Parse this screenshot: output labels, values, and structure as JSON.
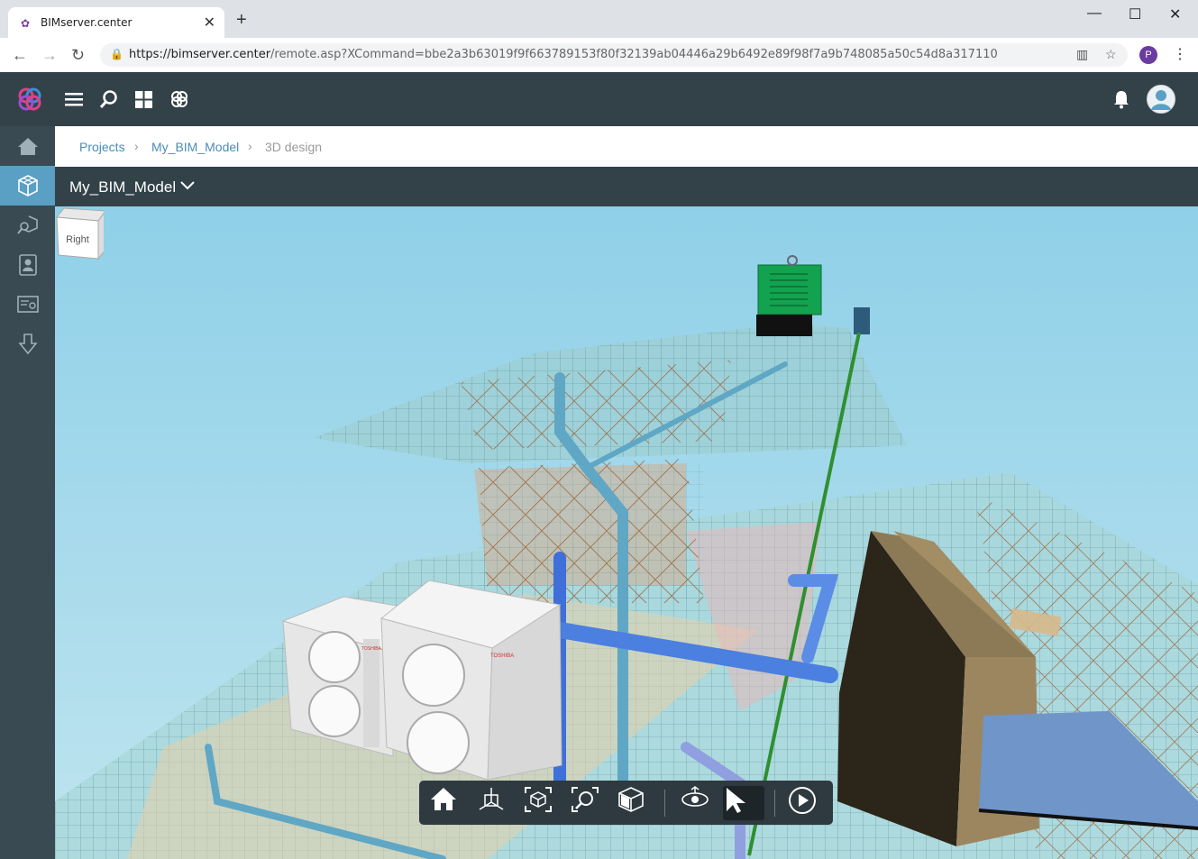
{
  "browser": {
    "tab_title": "BIMserver.center",
    "new_tab": "+",
    "tab_close": "✕",
    "url_host": "https://bimserver.center",
    "url_path": "/remote.asp?XCommand=bbe2a3b63019f9f663789153f80f32139ab04446a29b6492e89f98f7a9b748085a50c54d8a317110",
    "profile_initial": "P",
    "window_controls": {
      "minimize": "—",
      "maximize": "☐",
      "close": "✕"
    }
  },
  "header": {
    "icons": [
      "logo-icon",
      "hamburger-menu-icon",
      "search-icon",
      "apps-grid-icon",
      "bimserver-icon",
      "bell-icon",
      "user-avatar-icon"
    ]
  },
  "sidebar": {
    "items": [
      {
        "name": "home-icon",
        "active": false
      },
      {
        "name": "3d-model-icon",
        "active": true
      },
      {
        "name": "model-search-icon",
        "active": false
      },
      {
        "name": "contacts-icon",
        "active": false
      },
      {
        "name": "certificate-icon",
        "active": false
      },
      {
        "name": "download-icon",
        "active": false
      }
    ]
  },
  "breadcrumb": {
    "items": [
      "Projects",
      "My_BIM_Model",
      "3D design"
    ]
  },
  "model": {
    "title": "My_BIM_Model"
  },
  "viewer": {
    "navcube_face": "Right",
    "brand_label_1": "TOSHIBA",
    "brand_label_2": "TOSHIBA",
    "toolbar": [
      {
        "name": "home-view-button",
        "active": false
      },
      {
        "name": "axes-button",
        "active": false
      },
      {
        "name": "fit-view-button",
        "active": false
      },
      {
        "name": "zoom-window-button",
        "active": false
      },
      {
        "name": "section-box-button",
        "active": false
      },
      {
        "name": "orbit-button",
        "active": false
      },
      {
        "name": "select-button",
        "active": true
      },
      {
        "name": "play-button",
        "active": false
      }
    ]
  },
  "colors": {
    "header_bg": "#334249",
    "sidebar_bg": "#3a4a52",
    "sidebar_active": "#5a9fc4",
    "link": "#4a8db8",
    "sky_top": "#8fd0e8",
    "sky_bottom": "#b8e2ee"
  }
}
